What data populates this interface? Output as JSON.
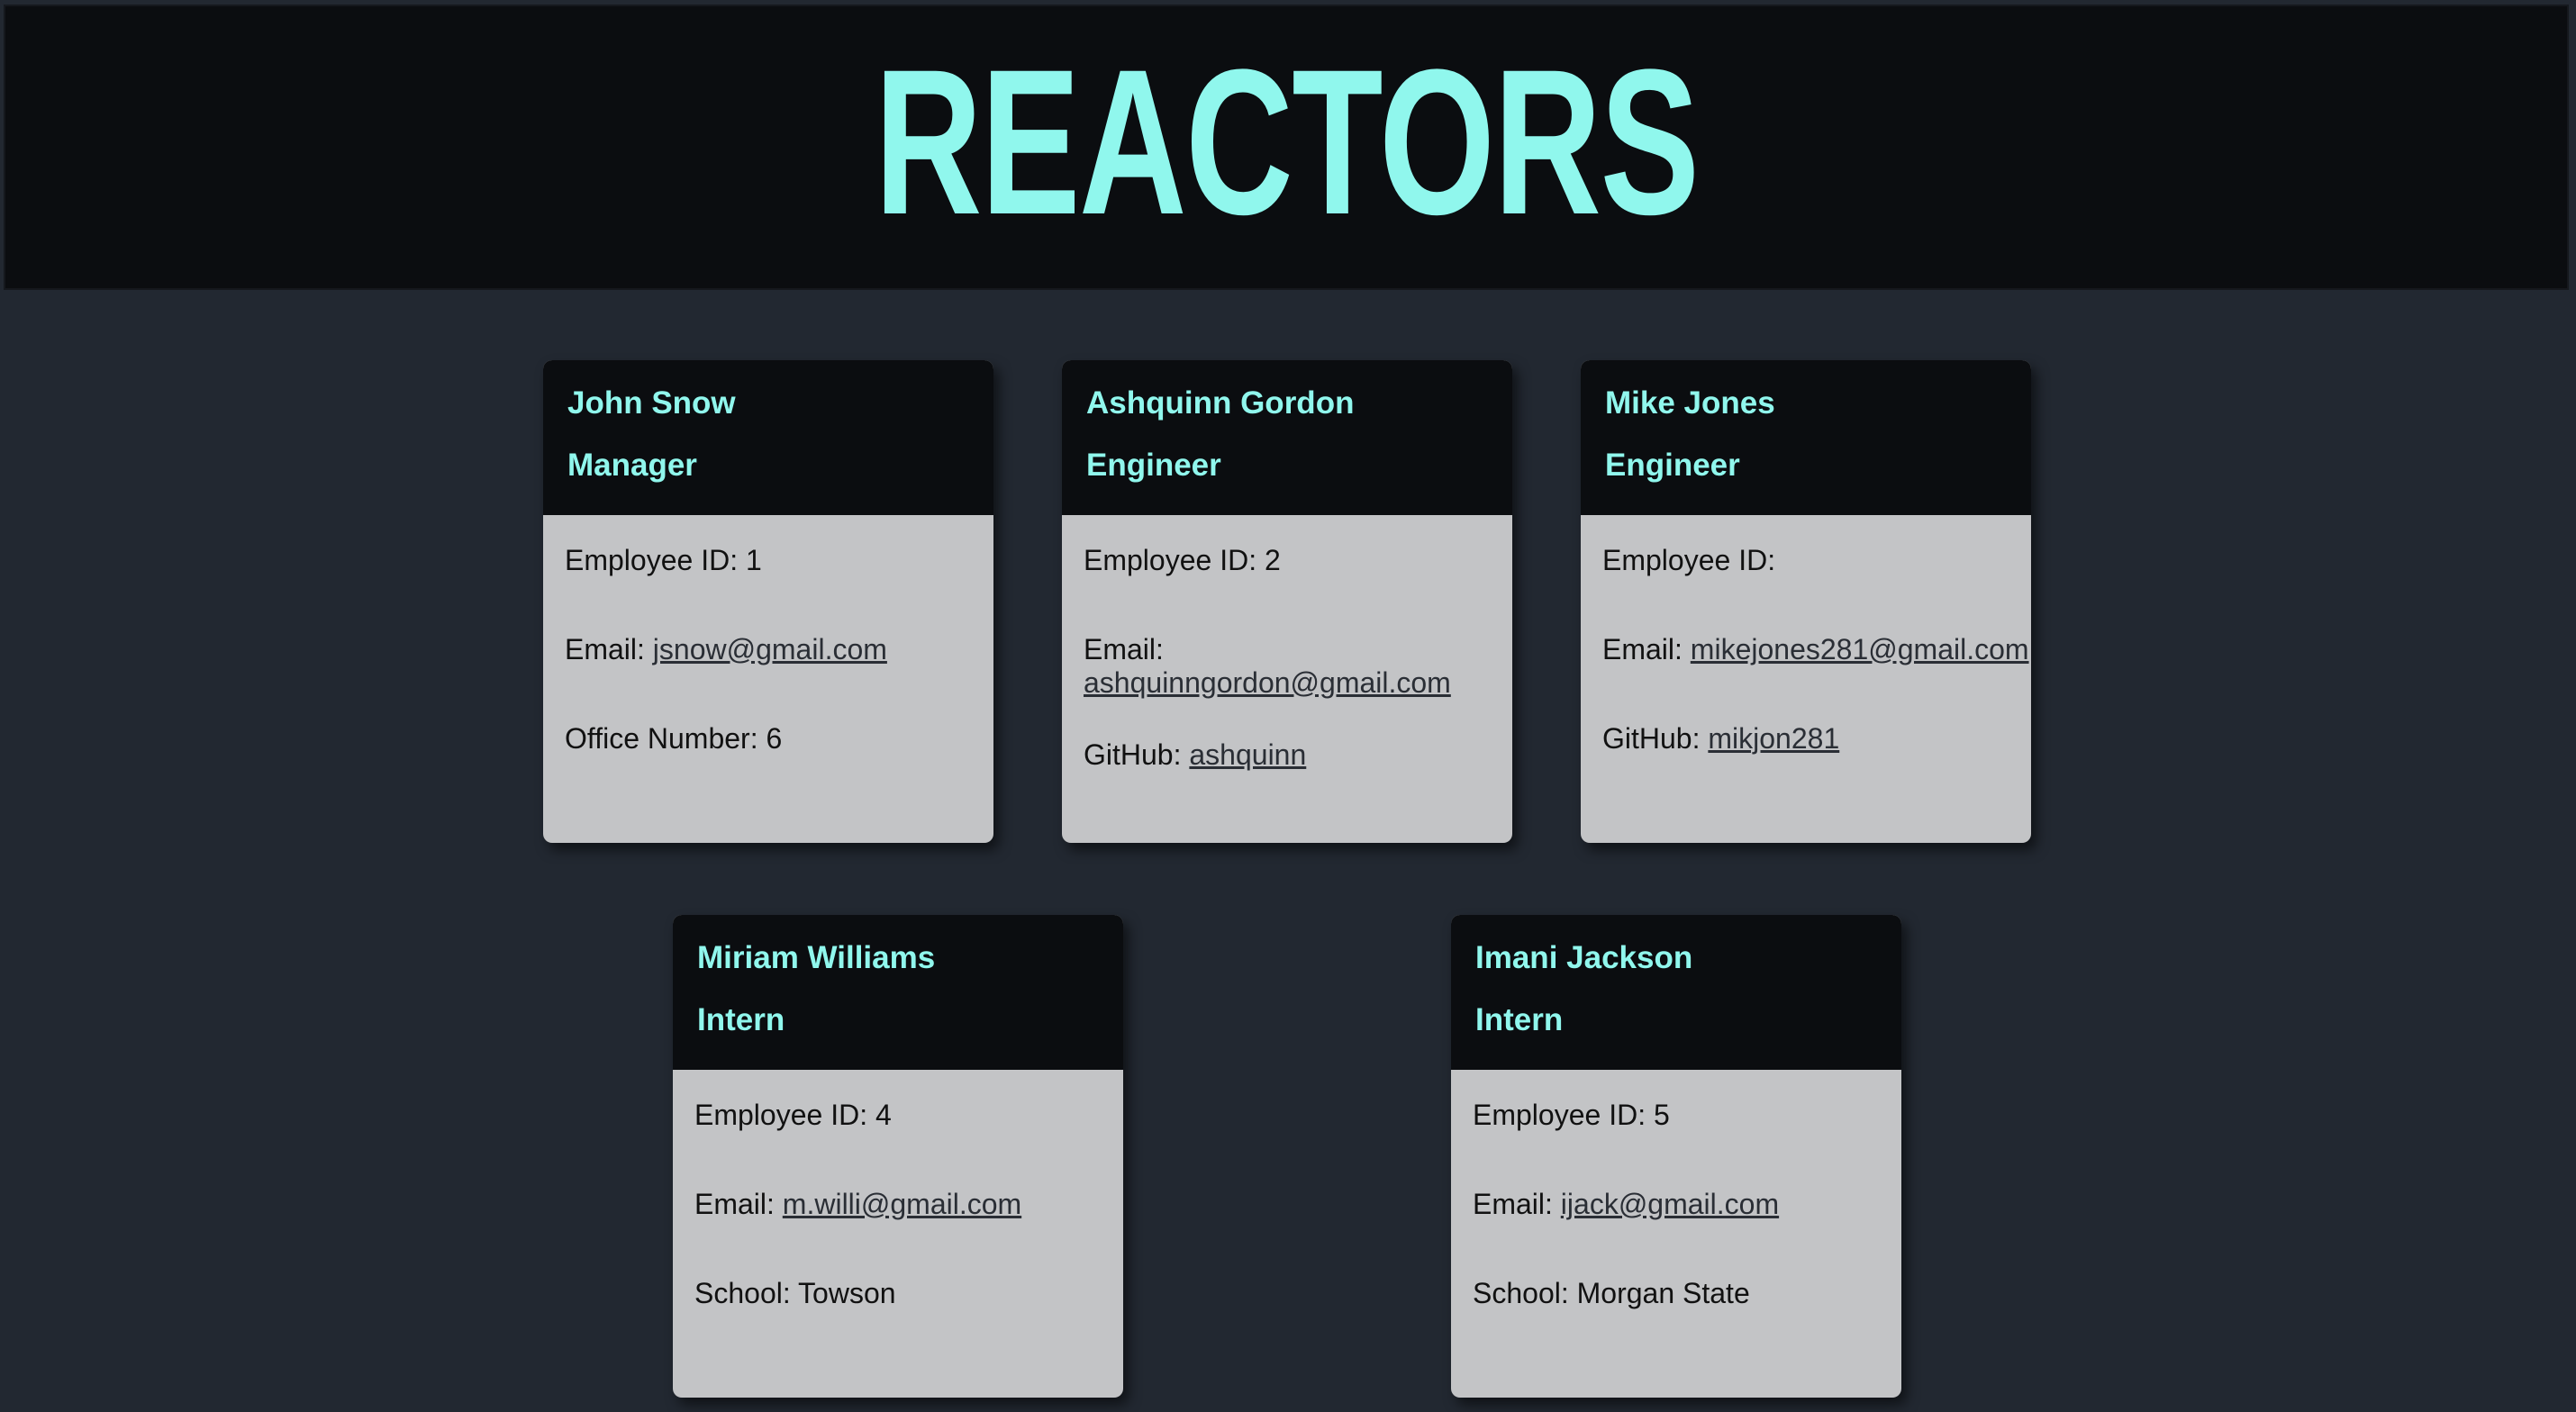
{
  "header": {
    "title": "REACTORS"
  },
  "labels": {
    "employee_id": "Employee ID:",
    "email": "Email:",
    "office": "Office Number:",
    "github": "GitHub:",
    "school": "School:"
  },
  "cards": [
    {
      "name": "John Snow",
      "role": "Manager",
      "id": "1",
      "email": "jsnow@gmail.com",
      "extra": "6"
    },
    {
      "name": "Ashquinn Gordon",
      "role": "Engineer",
      "id": "2",
      "email": "ashquinngordon@gmail.com",
      "extra": "ashquinn"
    },
    {
      "name": "Mike Jones",
      "role": "Engineer",
      "id": "",
      "email": "mikejones281@gmail.com",
      "extra": "mikjon281"
    },
    {
      "name": "Miriam Williams",
      "role": "Intern",
      "id": "4",
      "email": "m.willi@gmail.com",
      "extra": "Towson"
    },
    {
      "name": "Imani Jackson",
      "role": "Intern",
      "id": "5",
      "email": "ijack@gmail.com",
      "extra": "Morgan State"
    }
  ],
  "colors": {
    "accent": "#90f7ed",
    "page_bg": "#222831",
    "header_bg": "#0b0d10",
    "card_body_bg": "#c3c4c6"
  }
}
